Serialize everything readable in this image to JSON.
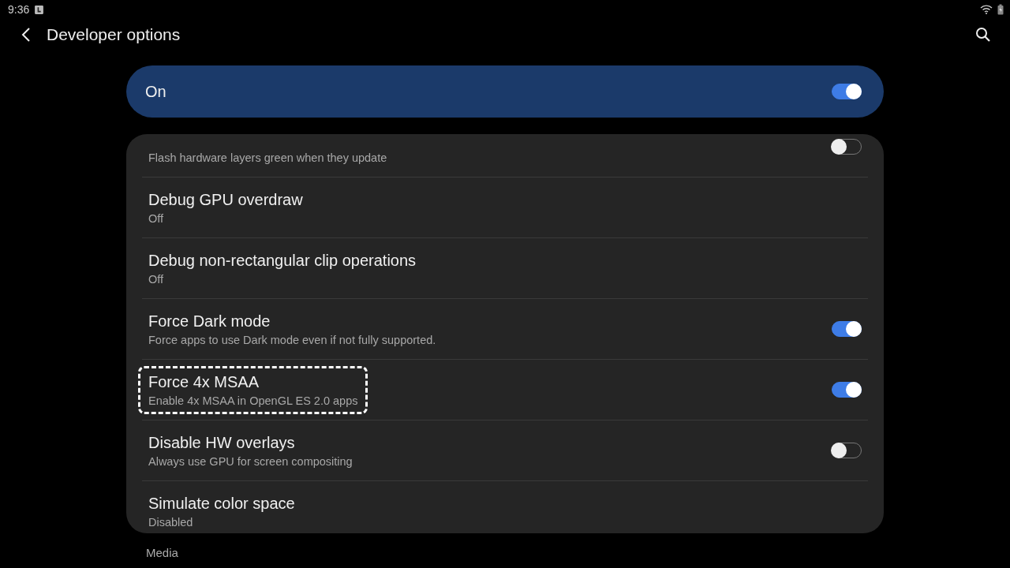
{
  "status_bar": {
    "time": "9:36"
  },
  "header": {
    "title": "Developer options"
  },
  "master_switch": {
    "label": "On",
    "on": true
  },
  "settings": [
    {
      "kind": "switch",
      "subtitle": "Flash hardware layers green when they update",
      "on": false,
      "highlighted": false
    },
    {
      "kind": "text",
      "title": "Debug GPU overdraw",
      "subtitle": "Off",
      "highlighted": false
    },
    {
      "kind": "text",
      "title": "Debug non-rectangular clip operations",
      "subtitle": "Off",
      "highlighted": false
    },
    {
      "kind": "switch",
      "title": "Force Dark mode",
      "subtitle": "Force apps to use Dark mode even if not fully supported.",
      "on": true,
      "highlighted": false
    },
    {
      "kind": "switch",
      "title": "Force 4x MSAA",
      "subtitle": "Enable 4x MSAA in OpenGL ES 2.0 apps",
      "on": true,
      "highlighted": true
    },
    {
      "kind": "switch",
      "title": "Disable HW overlays",
      "subtitle": "Always use GPU for screen compositing",
      "on": false,
      "highlighted": false
    },
    {
      "kind": "text",
      "title": "Simulate color space",
      "subtitle": "Disabled",
      "highlighted": false
    }
  ],
  "section_header": "Media"
}
